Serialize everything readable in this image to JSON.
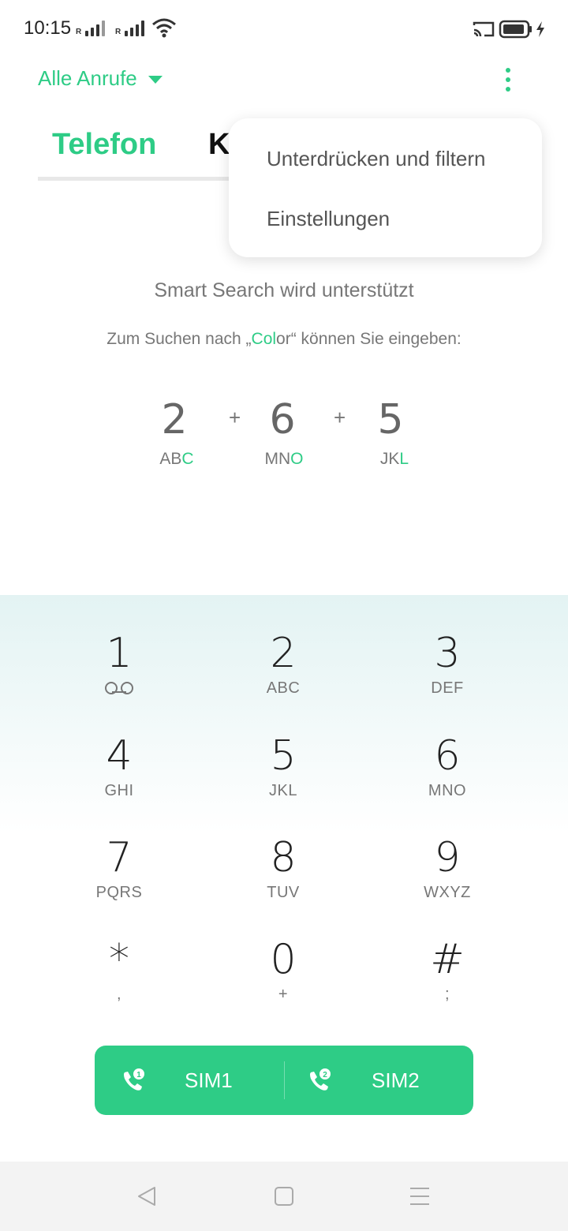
{
  "status_bar": {
    "time": "10:15",
    "signal_1_label": "R",
    "signal_2_label": "R",
    "icons": [
      "signal-icon",
      "signal-icon",
      "wifi-icon",
      "cast-icon",
      "battery-icon",
      "charging-icon"
    ]
  },
  "header": {
    "filter_label": "Alle Anrufe",
    "more_icon": "more-vertical-icon"
  },
  "tabs": [
    {
      "label": "Telefon",
      "active": true
    },
    {
      "label": "K",
      "active": false
    }
  ],
  "menu": {
    "items": [
      "Unterdrücken und filtern",
      "Einstellungen"
    ]
  },
  "smart_search": {
    "title": "Smart Search wird unterstützt",
    "hint_prefix": "Zum Suchen nach „",
    "hint_highlight": "Col",
    "hint_rest": "or“ können Sie eingeben:",
    "plus": "+",
    "example": [
      {
        "digit": "2",
        "letters": "AB",
        "highlight": "C"
      },
      {
        "digit": "6",
        "letters": "MN",
        "highlight": "O"
      },
      {
        "digit": "5",
        "letters": "JK",
        "highlight": "L"
      }
    ]
  },
  "keypad": {
    "keys": [
      {
        "digit": "1",
        "sub": "",
        "icon": "voicemail-icon"
      },
      {
        "digit": "2",
        "sub": "ABC"
      },
      {
        "digit": "3",
        "sub": "DEF"
      },
      {
        "digit": "4",
        "sub": "GHI"
      },
      {
        "digit": "5",
        "sub": "JKL"
      },
      {
        "digit": "6",
        "sub": "MNO"
      },
      {
        "digit": "7",
        "sub": "PQRS"
      },
      {
        "digit": "8",
        "sub": "TUV"
      },
      {
        "digit": "9",
        "sub": "WXYZ"
      },
      {
        "digit": "*",
        "sub": ","
      },
      {
        "digit": "0",
        "sub": "+"
      },
      {
        "digit": "#",
        "sub": ";"
      }
    ]
  },
  "sim": {
    "sim1_label": "SIM1",
    "sim2_label": "SIM2",
    "sim1_badge": "1",
    "sim2_badge": "2"
  },
  "nav_bar": {
    "icons": [
      "back-icon",
      "home-icon",
      "recents-icon"
    ]
  },
  "colors": {
    "accent": "#2ecc86",
    "keypad_gradient_top": "#e3f3f3"
  }
}
